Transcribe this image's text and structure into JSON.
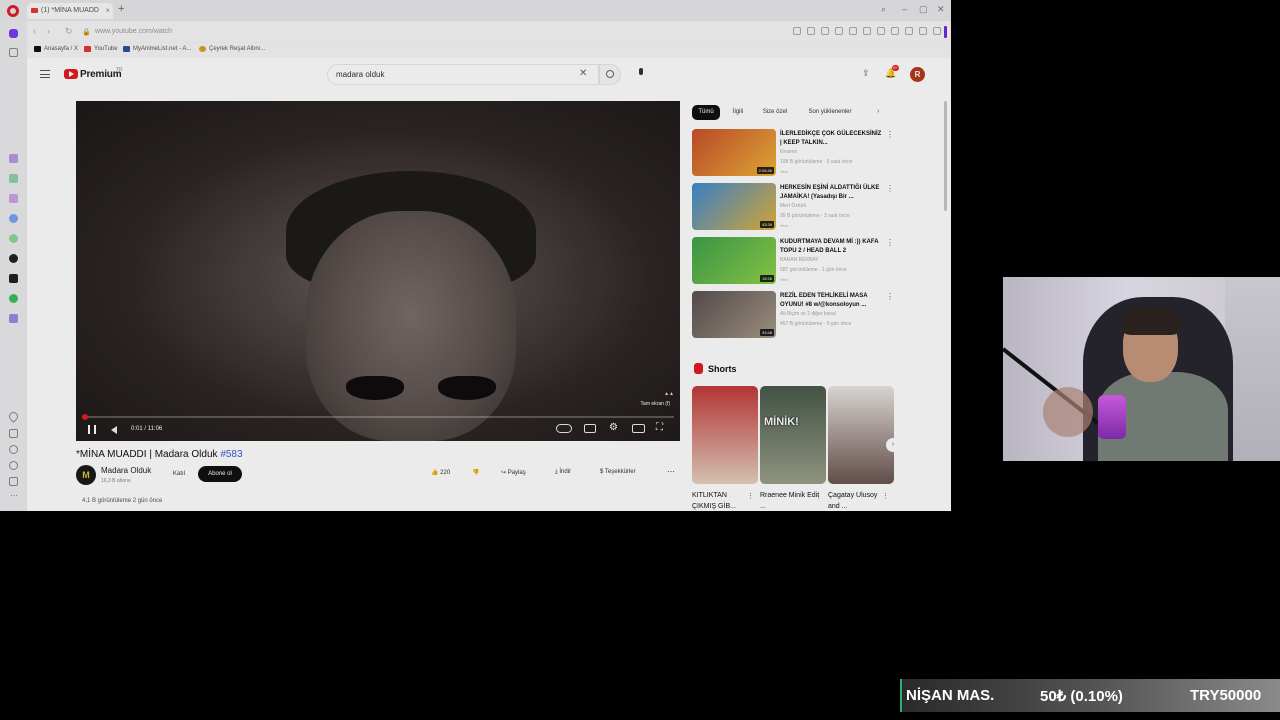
{
  "browser": {
    "tab_title": "(1) *MİNA MUADD",
    "url": "www.youtube.com/watch",
    "bookmarks": [
      "Anasayfa / X",
      "YouTube",
      "MyAnimeList.net - A...",
      "Çeyrek Reşat Altını..."
    ]
  },
  "youtube": {
    "brand": "Premium",
    "brand_country": "TR",
    "search_query": "madara olduk",
    "avatar_letter": "R",
    "notification_count": "9+",
    "player": {
      "time": "0:01 / 11:06",
      "fullscreen_hint": "Tam ekran (f)",
      "progress": 0.002
    },
    "video": {
      "title": "*MİNA MUADDI | Madara Olduk",
      "hashtag": "#583",
      "channel_name": "Madara Olduk",
      "channel_subs": "16,3 B abone",
      "channel_initial": "M",
      "join": "Katıl",
      "subscribe": "Abone ol",
      "likes": "220",
      "share": "Paylaş",
      "download": "İndir",
      "thanks": "Teşekkürler",
      "views_date": "4,1 B görüntüleme  2 gün önce"
    },
    "chips": [
      "Tümü",
      "İlgili",
      "Size özel",
      "Son yüklenenler"
    ],
    "recommendations": [
      {
        "title": "İLERLEDİKÇE ÇOK GÜLECEKSİNİZ | KEEP TALKIN...",
        "channel": "Elraenn",
        "meta": "198 B görüntüleme · 5 saat önce",
        "badge": "Yeni",
        "duration": "2:26:46",
        "colors": [
          "#c8502a",
          "#f0b23a"
        ]
      },
      {
        "title": "HERKESİN EŞİNİ ALDATTIĞI ÜLKE JAMAİKA! (Yasadışı Bir ...",
        "channel": "Mert Öztürk",
        "meta": "95 B görüntüleme · 3 saat önce",
        "badge": "Yeni",
        "duration": "43:39",
        "colors": [
          "#3b8bd6",
          "#e5b23c"
        ]
      },
      {
        "title": "KUDURTMAYA DEVAM Mİ :)) KAFA TOPU 2 / HEAD BALL 2",
        "channel": "BARAN BERBAY",
        "meta": "587 görüntüleme · 1 gün önce",
        "badge": "Yeni",
        "duration": "15:26",
        "colors": [
          "#3fa14a",
          "#8fd24a"
        ]
      },
      {
        "title": "REZİL EDEN TEHLİKELİ MASA OYUNU! #8 w/@konsoloyun ...",
        "channel": "Ali Biçim ve 2 diğer kanal",
        "meta": "457 B görüntüleme · 9 gün önce",
        "badge": "",
        "duration": "33:48",
        "colors": [
          "#5a5050",
          "#a89a8a"
        ]
      }
    ],
    "shorts_label": "Shorts",
    "shorts": [
      {
        "caption": "KITLIKTAN ÇIKMIŞ GİB...",
        "colors": [
          "#c23a3a",
          "#e6d1c0"
        ],
        "overlay": ""
      },
      {
        "caption": "Rraenee Minik Edit ...",
        "colors": [
          "#4a5a4a",
          "#9aa08a"
        ],
        "overlay": "MİNİK!"
      },
      {
        "caption": "Çagatay Ulusoy and ...",
        "colors": [
          "#ebe6e2",
          "#6a5450"
        ],
        "overlay": ""
      }
    ]
  },
  "donation": {
    "name": "NİŞAN MAS.",
    "amount": "50₺ (0.10%)",
    "goal": "TRY50000",
    "accent": "#27b36a"
  }
}
